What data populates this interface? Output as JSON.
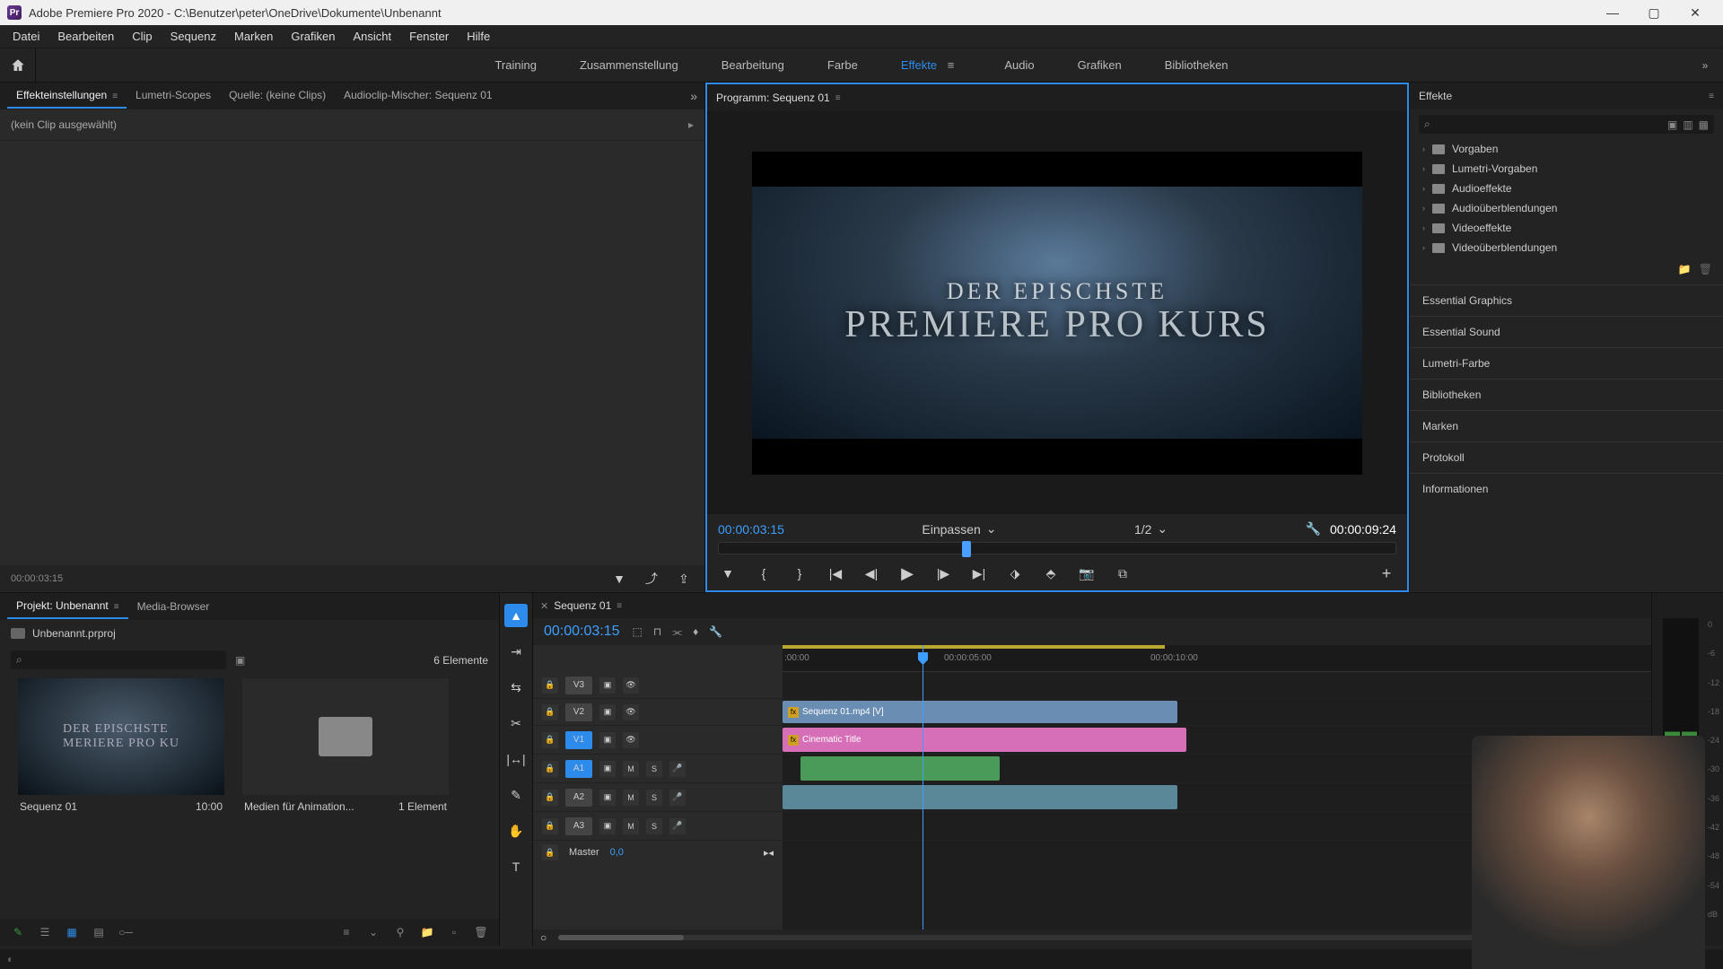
{
  "app": {
    "title": "Adobe Premiere Pro 2020 - C:\\Benutzer\\peter\\OneDrive\\Dokumente\\Unbenannt"
  },
  "menubar": [
    "Datei",
    "Bearbeiten",
    "Clip",
    "Sequenz",
    "Marken",
    "Grafiken",
    "Ansicht",
    "Fenster",
    "Hilfe"
  ],
  "workspaces": {
    "items": [
      "Training",
      "Zusammenstellung",
      "Bearbeitung",
      "Farbe",
      "Effekte",
      "Audio",
      "Grafiken",
      "Bibliotheken"
    ],
    "active": "Effekte"
  },
  "source_panel": {
    "tabs": [
      "Effekteinstellungen",
      "Lumetri-Scopes",
      "Quelle: (keine Clips)",
      "Audioclip-Mischer: Sequenz 01"
    ],
    "active": 0,
    "noclip": "(kein Clip ausgewählt)",
    "footer_tc": "00:00:03:15"
  },
  "program_panel": {
    "tab": "Programm: Sequenz 01",
    "preview_line1": "DER EPISCHSTE",
    "preview_line2": "PREMIERE PRO KURS",
    "tc_in": "00:00:03:15",
    "fit": "Einpassen",
    "res": "1/2",
    "tc_out": "00:00:09:24"
  },
  "effects_panel": {
    "tab": "Effekte",
    "tree": [
      "Vorgaben",
      "Lumetri-Vorgaben",
      "Audioeffekte",
      "Audioüberblendungen",
      "Videoeffekte",
      "Videoüberblendungen"
    ],
    "accordion": [
      "Essential Graphics",
      "Essential Sound",
      "Lumetri-Farbe",
      "Bibliotheken",
      "Marken",
      "Protokoll",
      "Informationen"
    ]
  },
  "project_panel": {
    "tabs": [
      "Projekt: Unbenannt",
      "Media-Browser"
    ],
    "active": 0,
    "file": "Unbenannt.prproj",
    "count": "6 Elemente",
    "bins": [
      {
        "name": "Sequenz 01",
        "meta": "10:00",
        "type": "seq"
      },
      {
        "name": "Medien für Animation...",
        "meta": "1 Element",
        "type": "folder"
      }
    ]
  },
  "timeline": {
    "tab": "Sequenz 01",
    "tc": "00:00:03:15",
    "ruler": [
      {
        "pos": 2,
        "label": ":00:00"
      },
      {
        "pos": 180,
        "label": "00:00:05:00"
      },
      {
        "pos": 410,
        "label": "00:00:10:00"
      }
    ],
    "video_tracks": [
      "V3",
      "V2",
      "V1"
    ],
    "audio_tracks": [
      "A1",
      "A2",
      "A3"
    ],
    "master_label": "Master",
    "master_val": "0,0",
    "clips": {
      "v2": "Sequenz 01.mp4 [V]",
      "v1": "Cinematic Title"
    }
  },
  "meters": {
    "scale": [
      "0",
      "-6",
      "-12",
      "-18",
      "-24",
      "-30",
      "-36",
      "-42",
      "-48",
      "-54",
      "dB"
    ],
    "solo": "S"
  }
}
